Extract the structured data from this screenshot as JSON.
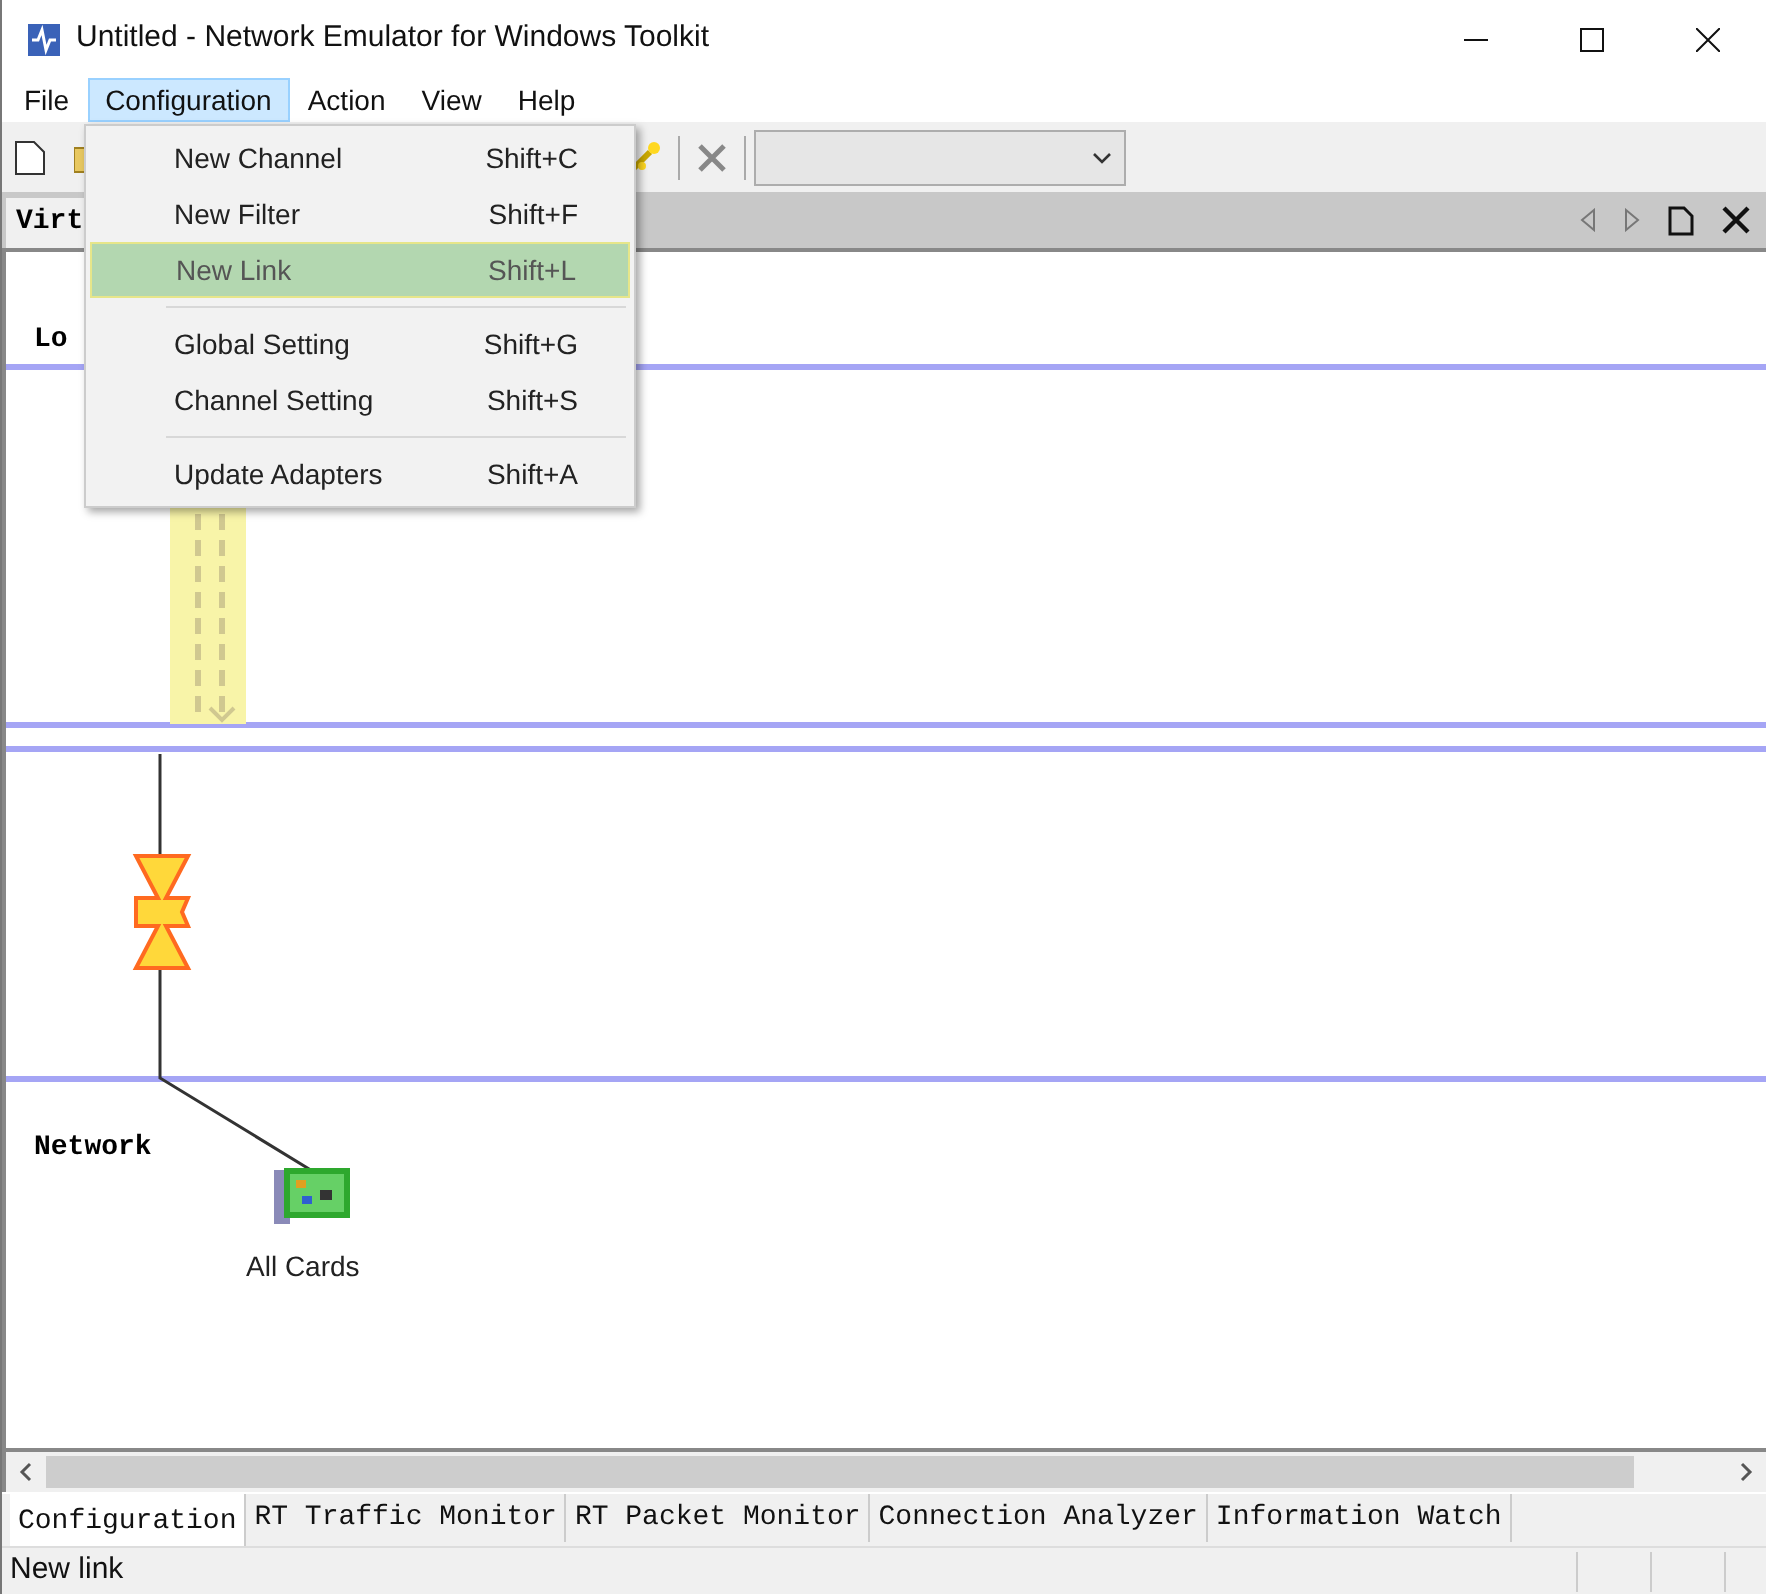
{
  "window": {
    "title": "Untitled - Network Emulator for Windows Toolkit"
  },
  "menu_bar": [
    {
      "label": "File",
      "selected": false
    },
    {
      "label": "Configuration",
      "selected": true
    },
    {
      "label": "Action",
      "selected": false
    },
    {
      "label": "View",
      "selected": false
    },
    {
      "label": "Help",
      "selected": false
    }
  ],
  "dropdown": [
    {
      "kind": "item",
      "label": "New Channel",
      "shortcut": "Shift+C",
      "selected": false
    },
    {
      "kind": "item",
      "label": "New Filter",
      "shortcut": "Shift+F",
      "selected": false
    },
    {
      "kind": "item",
      "label": "New Link",
      "shortcut": "Shift+L",
      "selected": true
    },
    {
      "kind": "separator"
    },
    {
      "kind": "item",
      "label": "Global Setting",
      "shortcut": "Shift+G",
      "selected": false
    },
    {
      "kind": "item",
      "label": "Channel Setting",
      "shortcut": "Shift+S",
      "selected": false
    },
    {
      "kind": "separator"
    },
    {
      "kind": "item",
      "label": "Update Adapters",
      "shortcut": "Shift+A",
      "selected": false
    }
  ],
  "document_tab": {
    "label": "Virt"
  },
  "canvas": {
    "sections": [
      {
        "label": "Lo"
      },
      {
        "label": "Network"
      }
    ],
    "adapter": {
      "label": "All Cards"
    }
  },
  "bottom_tabs": [
    {
      "label": "Configuration",
      "selected": true
    },
    {
      "label": "RT Traffic Monitor",
      "selected": false
    },
    {
      "label": "RT Packet Monitor",
      "selected": false
    },
    {
      "label": "Connection Analyzer",
      "selected": false
    },
    {
      "label": "Information Watch",
      "selected": false
    }
  ],
  "status_bar": {
    "text": "New link"
  }
}
